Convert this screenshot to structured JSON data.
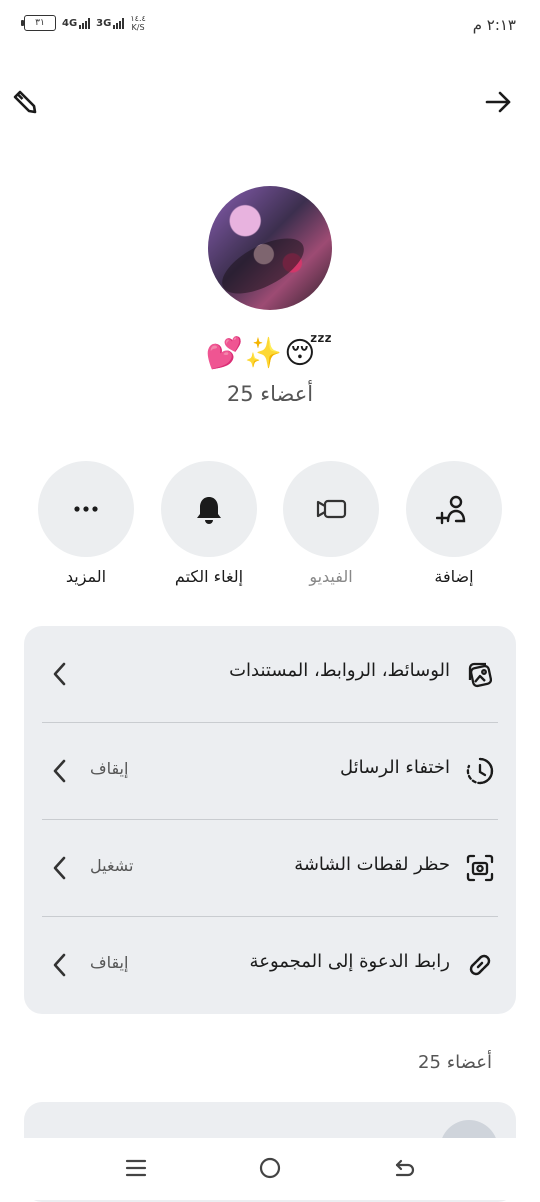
{
  "status_bar": {
    "time": "٢:١٣ م",
    "battery": "٣١",
    "network_1": "4G",
    "network_2": "3G",
    "speed_value": "١٤.٤",
    "speed_unit": "K/S"
  },
  "icons": {
    "edit": "pencil-icon",
    "back": "arrow-right-icon",
    "add": "add-person-icon",
    "video": "video-camera-icon",
    "unmute": "bell-icon",
    "more": "more-dots-icon",
    "media": "media-gallery-icon",
    "disappearing": "timer-icon",
    "screenshot": "screenshot-camera-icon",
    "invite": "link-icon",
    "chevron": "chevron-left-icon"
  },
  "group": {
    "title": "💕✨😴",
    "member_count": "25 أعضاء"
  },
  "actions": [
    {
      "label": "إضافة"
    },
    {
      "label": "الفيديو"
    },
    {
      "label": "إلغاء الكتم"
    },
    {
      "label": "المزيد"
    }
  ],
  "menu": [
    {
      "label": "الوسائط، الروابط، المستندات",
      "status": ""
    },
    {
      "label": "اختفاء الرسائل",
      "status": "إيقاف"
    },
    {
      "label": "حظر لقطات الشاشة",
      "status": "تشغيل"
    },
    {
      "label": "رابط الدعوة إلى المجموعة",
      "status": "إيقاف"
    }
  ],
  "members_section": {
    "header": "25 أعضاء"
  },
  "colors": {
    "background": "#ffffff",
    "card": "#eceef1",
    "circle": "#eceef0",
    "text": "#1b1b1b",
    "muted": "#555555"
  }
}
